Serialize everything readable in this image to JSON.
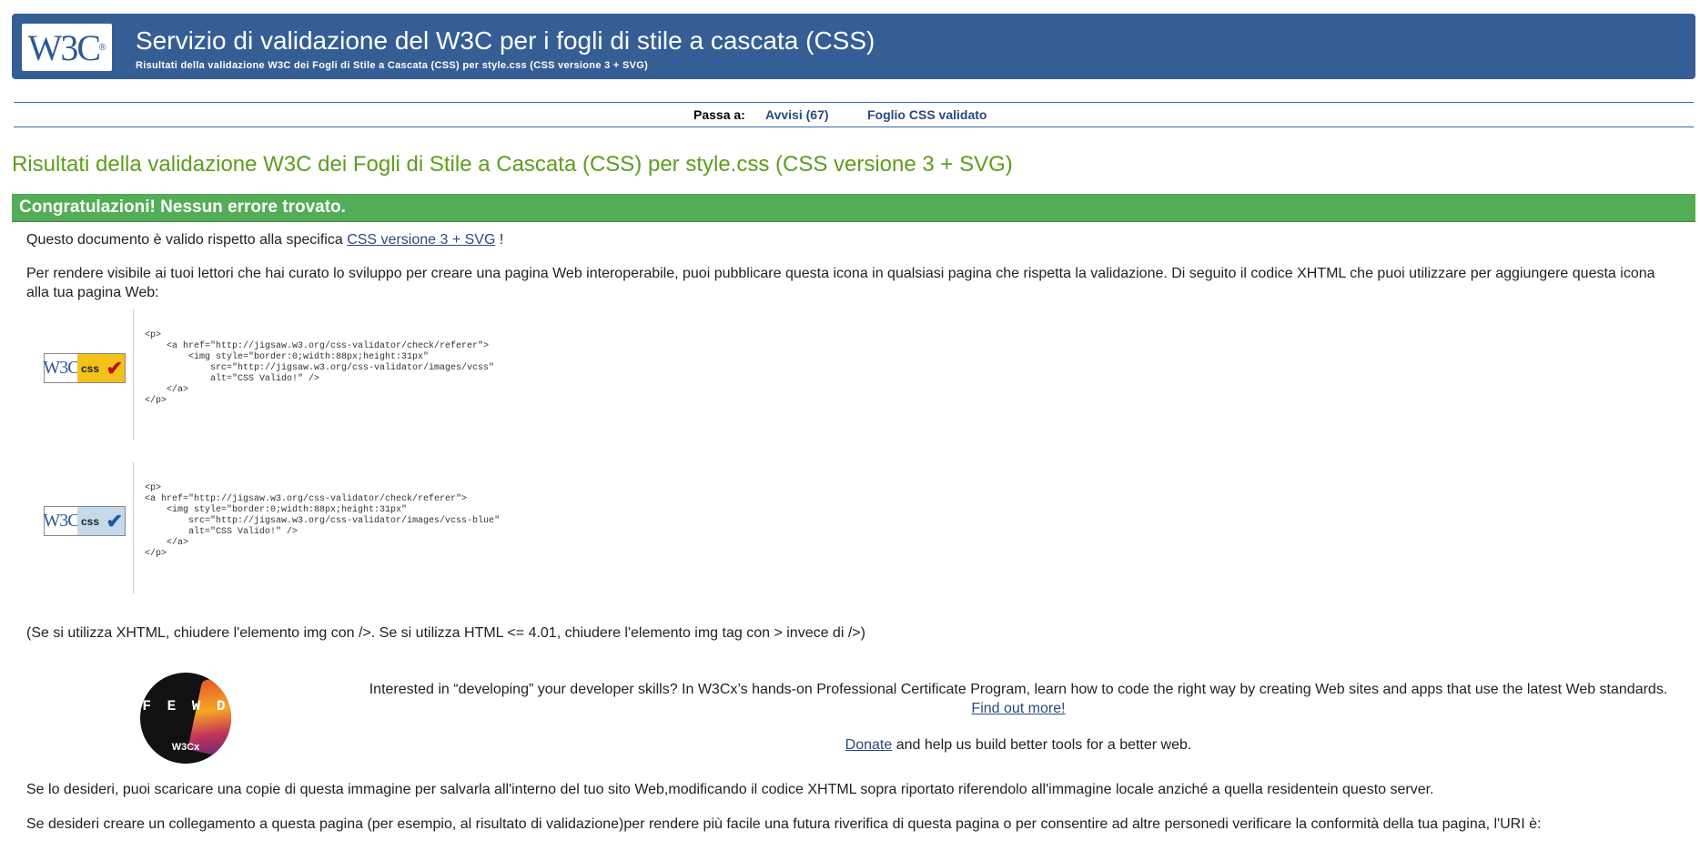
{
  "header": {
    "logo_text": "W3C",
    "title": "Servizio di validazione del W3C per i fogli di stile a cascata (CSS)",
    "subtitle": "Risultati della validazione W3C dei Fogli di Stile a Cascata (CSS) per style.css (CSS versione 3 + SVG)"
  },
  "jumpbar": {
    "label": "Passa a:",
    "warnings": "Avvisi (67)",
    "valid": "Foglio CSS validato"
  },
  "results_title": "Risultati della validazione W3C dei Fogli di Stile a Cascata (CSS) per style.css (CSS versione 3 + SVG)",
  "congrats": "Congratulazioni! Nessun errore trovato.",
  "valid_para": {
    "before": "Questo documento è valido rispetto alla specifica ",
    "link": "CSS versione 3 + SVG",
    "after": " !"
  },
  "visible_para": "Per rendere visibile ai tuoi lettori che hai curato lo sviluppo per creare una pagina Web interoperabile, puoi pubblicare questa icona in qualsiasi pagina che rispetta la validazione. Di seguito il codice XHTML che puoi utilizzare per aggiungere questa icona alla tua pagina Web:",
  "badges": [
    {
      "w3": "W3C",
      "css": "css",
      "code": "<p>\n    <a href=\"http://jigsaw.w3.org/css-validator/check/referer\">\n        <img style=\"border:0;width:88px;height:31px\"\n            src=\"http://jigsaw.w3.org/css-validator/images/vcss\"\n            alt=\"CSS Valido!\" />\n    </a>\n</p>"
    },
    {
      "w3": "W3C",
      "css": "css",
      "code": "<p>\n<a href=\"http://jigsaw.w3.org/css-validator/check/referer\">\n    <img style=\"border:0;width:88px;height:31px\"\n        src=\"http://jigsaw.w3.org/css-validator/images/vcss-blue\"\n        alt=\"CSS Valido!\" />\n    </a>\n</p>"
    }
  ],
  "note_para": "(Se si utilizza XHTML, chiudere l'elemento img con />. Se si utilizza HTML <= 4.01, chiudere l'elemento img tag con > invece di />)",
  "promo": {
    "logo_letters": "F E W D",
    "logo_brand": "W3Cx",
    "text": "Interested in “developing” your developer skills? In W3Cx’s hands-on Professional Certificate Program, learn how to code the right way by creating Web sites and apps that use the latest Web standards.",
    "find_out": "Find out more!",
    "donate_link": "Donate",
    "donate_after": " and help us build better tools for a better web."
  },
  "download_para": "Se lo desideri, puoi scaricare una copie di questa immagine per salvarla all'interno del tuo sito Web,modificando il codice XHTML sopra riportato riferendolo all'immagine locale anziché a quella residentein questo server.",
  "link_para": "Se desideri creare un collegamento a questa pagina (per esempio, al risultato di validazione)per rendere più facile una futura riverifica di questa pagina o per consentire ad altre personedi verificare la conformità della tua pagina, l'URI è:",
  "colors": {
    "banner": "#355e95",
    "title_green": "#5d9e1c",
    "congrats_green": "#53ad56",
    "link_blue": "#2a4a7f"
  }
}
